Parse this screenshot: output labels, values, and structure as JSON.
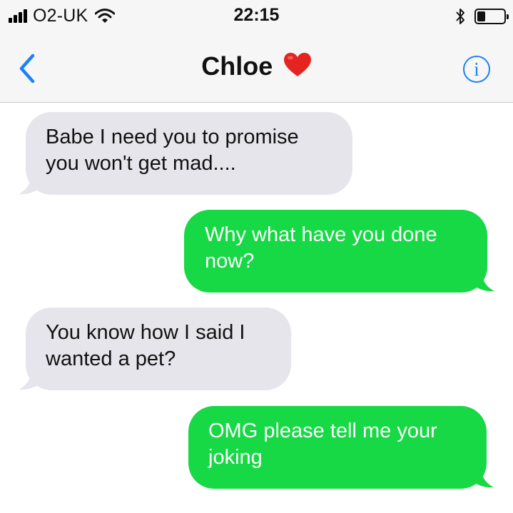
{
  "status_bar": {
    "carrier": "O2-UK",
    "time": "22:15",
    "signal_bars": 4,
    "battery_level_fraction": 0.3,
    "icons": [
      "signal-icon",
      "wifi-icon",
      "bluetooth-icon",
      "battery-icon"
    ]
  },
  "nav": {
    "back_icon": "chevron-left-icon",
    "contact_name": "Chloe",
    "title_emoji": "heart-icon",
    "info_label": "i"
  },
  "colors": {
    "accent_blue": "#1a82f6",
    "outgoing_bubble": "#17d845",
    "incoming_bubble": "#e6e5eb",
    "bar_background": "#f6f6f7"
  },
  "messages": [
    {
      "direction": "incoming",
      "lines": [
        "Babe I need you to promise",
        "you won't get mad...."
      ]
    },
    {
      "direction": "outgoing",
      "lines": [
        "Why what have you done",
        "now?"
      ]
    },
    {
      "direction": "incoming",
      "lines": [
        "You know how I said I",
        "wanted a pet?"
      ]
    },
    {
      "direction": "outgoing",
      "lines": [
        "OMG please tell me your",
        "joking"
      ]
    }
  ]
}
